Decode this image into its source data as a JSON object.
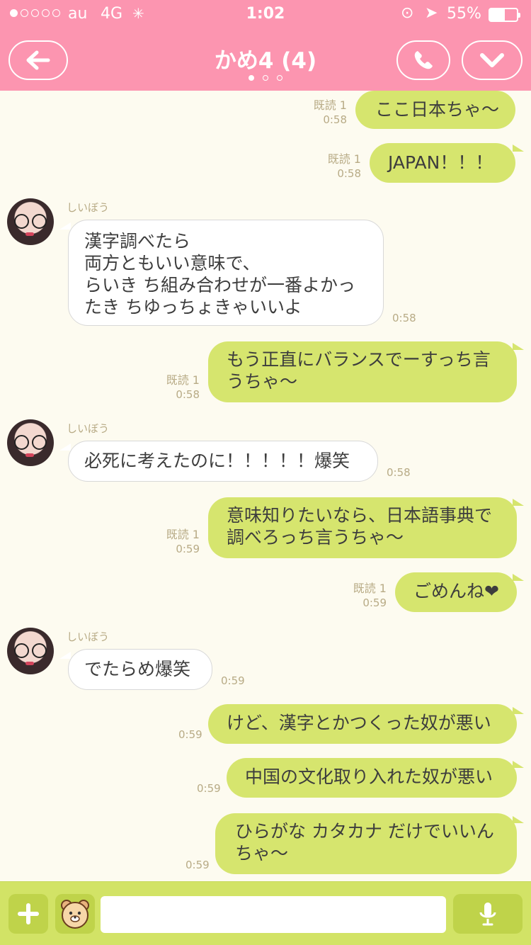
{
  "status": {
    "carrier": "au",
    "network": "4G",
    "time": "1:02",
    "battery": "55%",
    "battery_level": 0.55,
    "signal_dots_filled": 1,
    "signal_dots_total": 5
  },
  "header": {
    "title": "かめ4 (4)",
    "page_dots": 3,
    "active_page": 0
  },
  "colors": {
    "header_bg": "#fc95b0",
    "outgoing_bubble": "#d6e56e",
    "incoming_bubble": "#ffffff",
    "chat_bg": "#fdfbf0",
    "meta_text": "#b8ab86",
    "input_bar_bg": "#d2e366"
  },
  "messages": [
    {
      "dir": "out",
      "lines": [
        "ここ日本ちゃ〜"
      ],
      "read": "既読 1",
      "time": "0:58"
    },
    {
      "dir": "out",
      "lines": [
        "JAPAN！！！"
      ],
      "read": "既読 1",
      "time": "0:58"
    },
    {
      "dir": "in",
      "sender": "しいぼう",
      "lines": [
        "漢字調べたら",
        "両方ともいい意味で、",
        "らいき ち組み合わせが一番よかっ",
        "たき ちゆっちょきゃいいよ"
      ],
      "time": "0:58"
    },
    {
      "dir": "out",
      "lines": [
        "もう正直にバランスでーすっち言",
        "うちゃ〜"
      ],
      "read": "既読 1",
      "time": "0:58"
    },
    {
      "dir": "in",
      "sender": "しいぼう",
      "lines": [
        "必死に考えたのに！！！！！爆笑"
      ],
      "time": "0:58"
    },
    {
      "dir": "out",
      "lines": [
        "意味知りたいなら、日本語事典で",
        "調べろっち言うちゃ〜"
      ],
      "read": "既読 1",
      "time": "0:59"
    },
    {
      "dir": "out",
      "lines": [
        "ごめんね❤"
      ],
      "read": "既読 1",
      "time": "0:59"
    },
    {
      "dir": "in",
      "sender": "しいぼう",
      "lines": [
        "でたらめ爆笑"
      ],
      "time": "0:59"
    },
    {
      "dir": "out",
      "lines": [
        "けど、漢字とかつくった奴が悪い"
      ],
      "read": "",
      "time": "0:59"
    },
    {
      "dir": "out",
      "lines": [
        "中国の文化取り入れた奴が悪い"
      ],
      "read": "",
      "time": "0:59"
    },
    {
      "dir": "out",
      "lines": [
        "ひらがな カタカナ だけでいいん",
        "ちゃ〜"
      ],
      "read": "",
      "time": "0:59"
    }
  ],
  "input": {
    "placeholder": ""
  },
  "icons": {
    "back": "arrow-left-icon",
    "call": "phone-icon",
    "more": "chevron-down-icon",
    "plus": "plus-icon",
    "sticker": "sticker-icon",
    "mic": "microphone-icon"
  }
}
